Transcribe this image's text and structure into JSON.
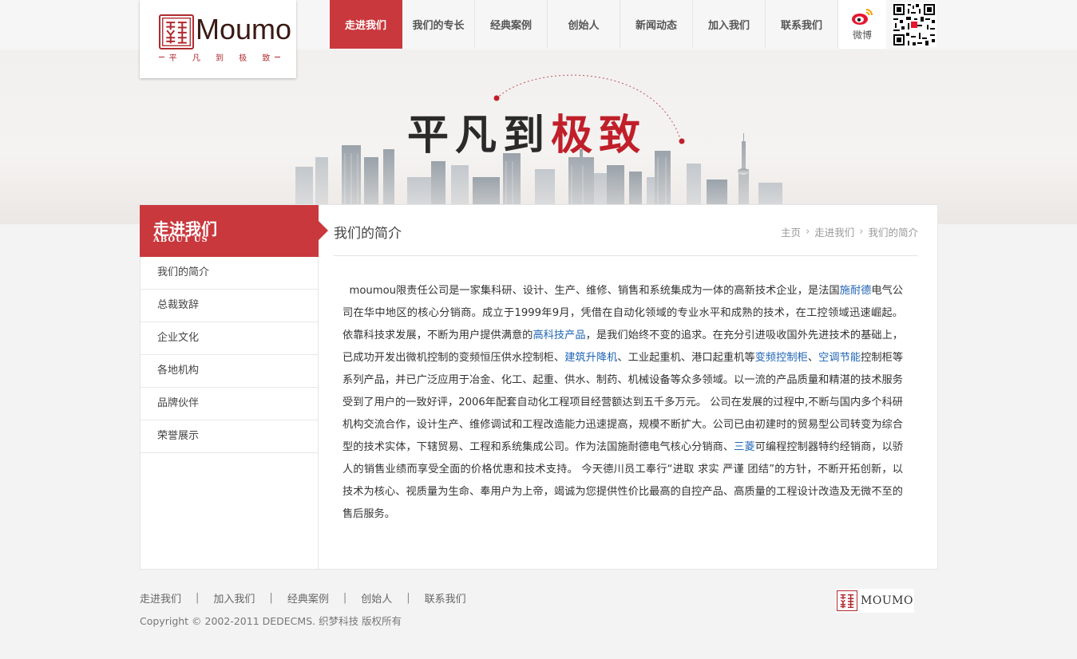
{
  "brand": {
    "name": "Moumo",
    "tagline": "平 凡 到 极 致",
    "footer_name": "MOUMO",
    "accent_color": "#c9383d",
    "seal_icon": "chinese-seal-icon"
  },
  "nav": {
    "items": [
      {
        "label": "走进我们",
        "active": true
      },
      {
        "label": "我们的专长"
      },
      {
        "label": "经典案例"
      },
      {
        "label": "创始人"
      },
      {
        "label": "新闻动态"
      },
      {
        "label": "加入我们"
      },
      {
        "label": "联系我们"
      }
    ],
    "weibo_label": "微博",
    "weibo_icon": "weibo-icon",
    "qr_icon": "qr-code-icon"
  },
  "banner": {
    "title_dark": "平凡到",
    "title_red": "极致"
  },
  "sidebar": {
    "title": "走进我们",
    "subtitle": "ABOUT US",
    "items": [
      {
        "label": "我们的简介"
      },
      {
        "label": "总裁致辞"
      },
      {
        "label": "企业文化"
      },
      {
        "label": "各地机构"
      },
      {
        "label": "品牌伙伴"
      },
      {
        "label": "荣誉展示"
      }
    ]
  },
  "main": {
    "title": "我们的简介",
    "breadcrumb": [
      "主页",
      "走进我们",
      "我们的简介"
    ],
    "article": {
      "p1": "moumou限责任公司是一家集科研、设计、生产、维修、销售和系统集成为一体的高新技术企业，是法国",
      "l1": "施耐德",
      "p2": "电气公司在华中地区的核心分销商。成立于1999年9月，凭借在自动化领域的专业水平和成熟的技术，在工控领域迅速崛起。 依靠科技求发展，不断为用户提供满意的",
      "l2": "高科技产品",
      "p3": "，是我们始终不变的追求。在充分引进吸收国外先进技术的基础上，已成功开发出微机控制的变频恒压供水控制柜、",
      "l3": "建筑升降机",
      "p4": "、工业起重机、港口起重机等",
      "l4": "变频控制柜",
      "p5": "、",
      "l5": "空调节能",
      "p6": "控制柜等系列产品，并已广泛应用于冶金、化工、起重、供水、制药、机械设备等众多领域。以一流的产品质量和精湛的技术服务受到了用户的一致好评，2006年配套自动化工程项目经营额达到五千多万元。 公司在发展的过程中,不断与国内多个科研机构交流合作，设计生产、维修调试和工程改造能力迅速提高，规模不断扩大。公司已由初建时的贸易型公司转变为综合型的技术实体，下辖贸易、工程和系统集成公司。作为法国施耐德电气核心分销商、",
      "l6": "三菱",
      "p7": "可编程控制器特约经销商，以骄人的销售业绩而享受全面的价格优惠和技术支持。 今天德川员工奉行“进取 求实 严谨 团结”的方针，不断开拓创新，以技术为核心、视质量为生命、奉用户为上帝，竭诚为您提供性价比最高的自控产品、高质量的工程设计改造及无微不至的售后服务。"
    }
  },
  "footer": {
    "links": [
      "走进我们",
      "加入我们",
      "经典案例",
      "创始人",
      "联系我们"
    ],
    "separator": "|",
    "copyright": "Copyright © 2002-2011 DEDECMS. 织梦科技 版权所有"
  }
}
